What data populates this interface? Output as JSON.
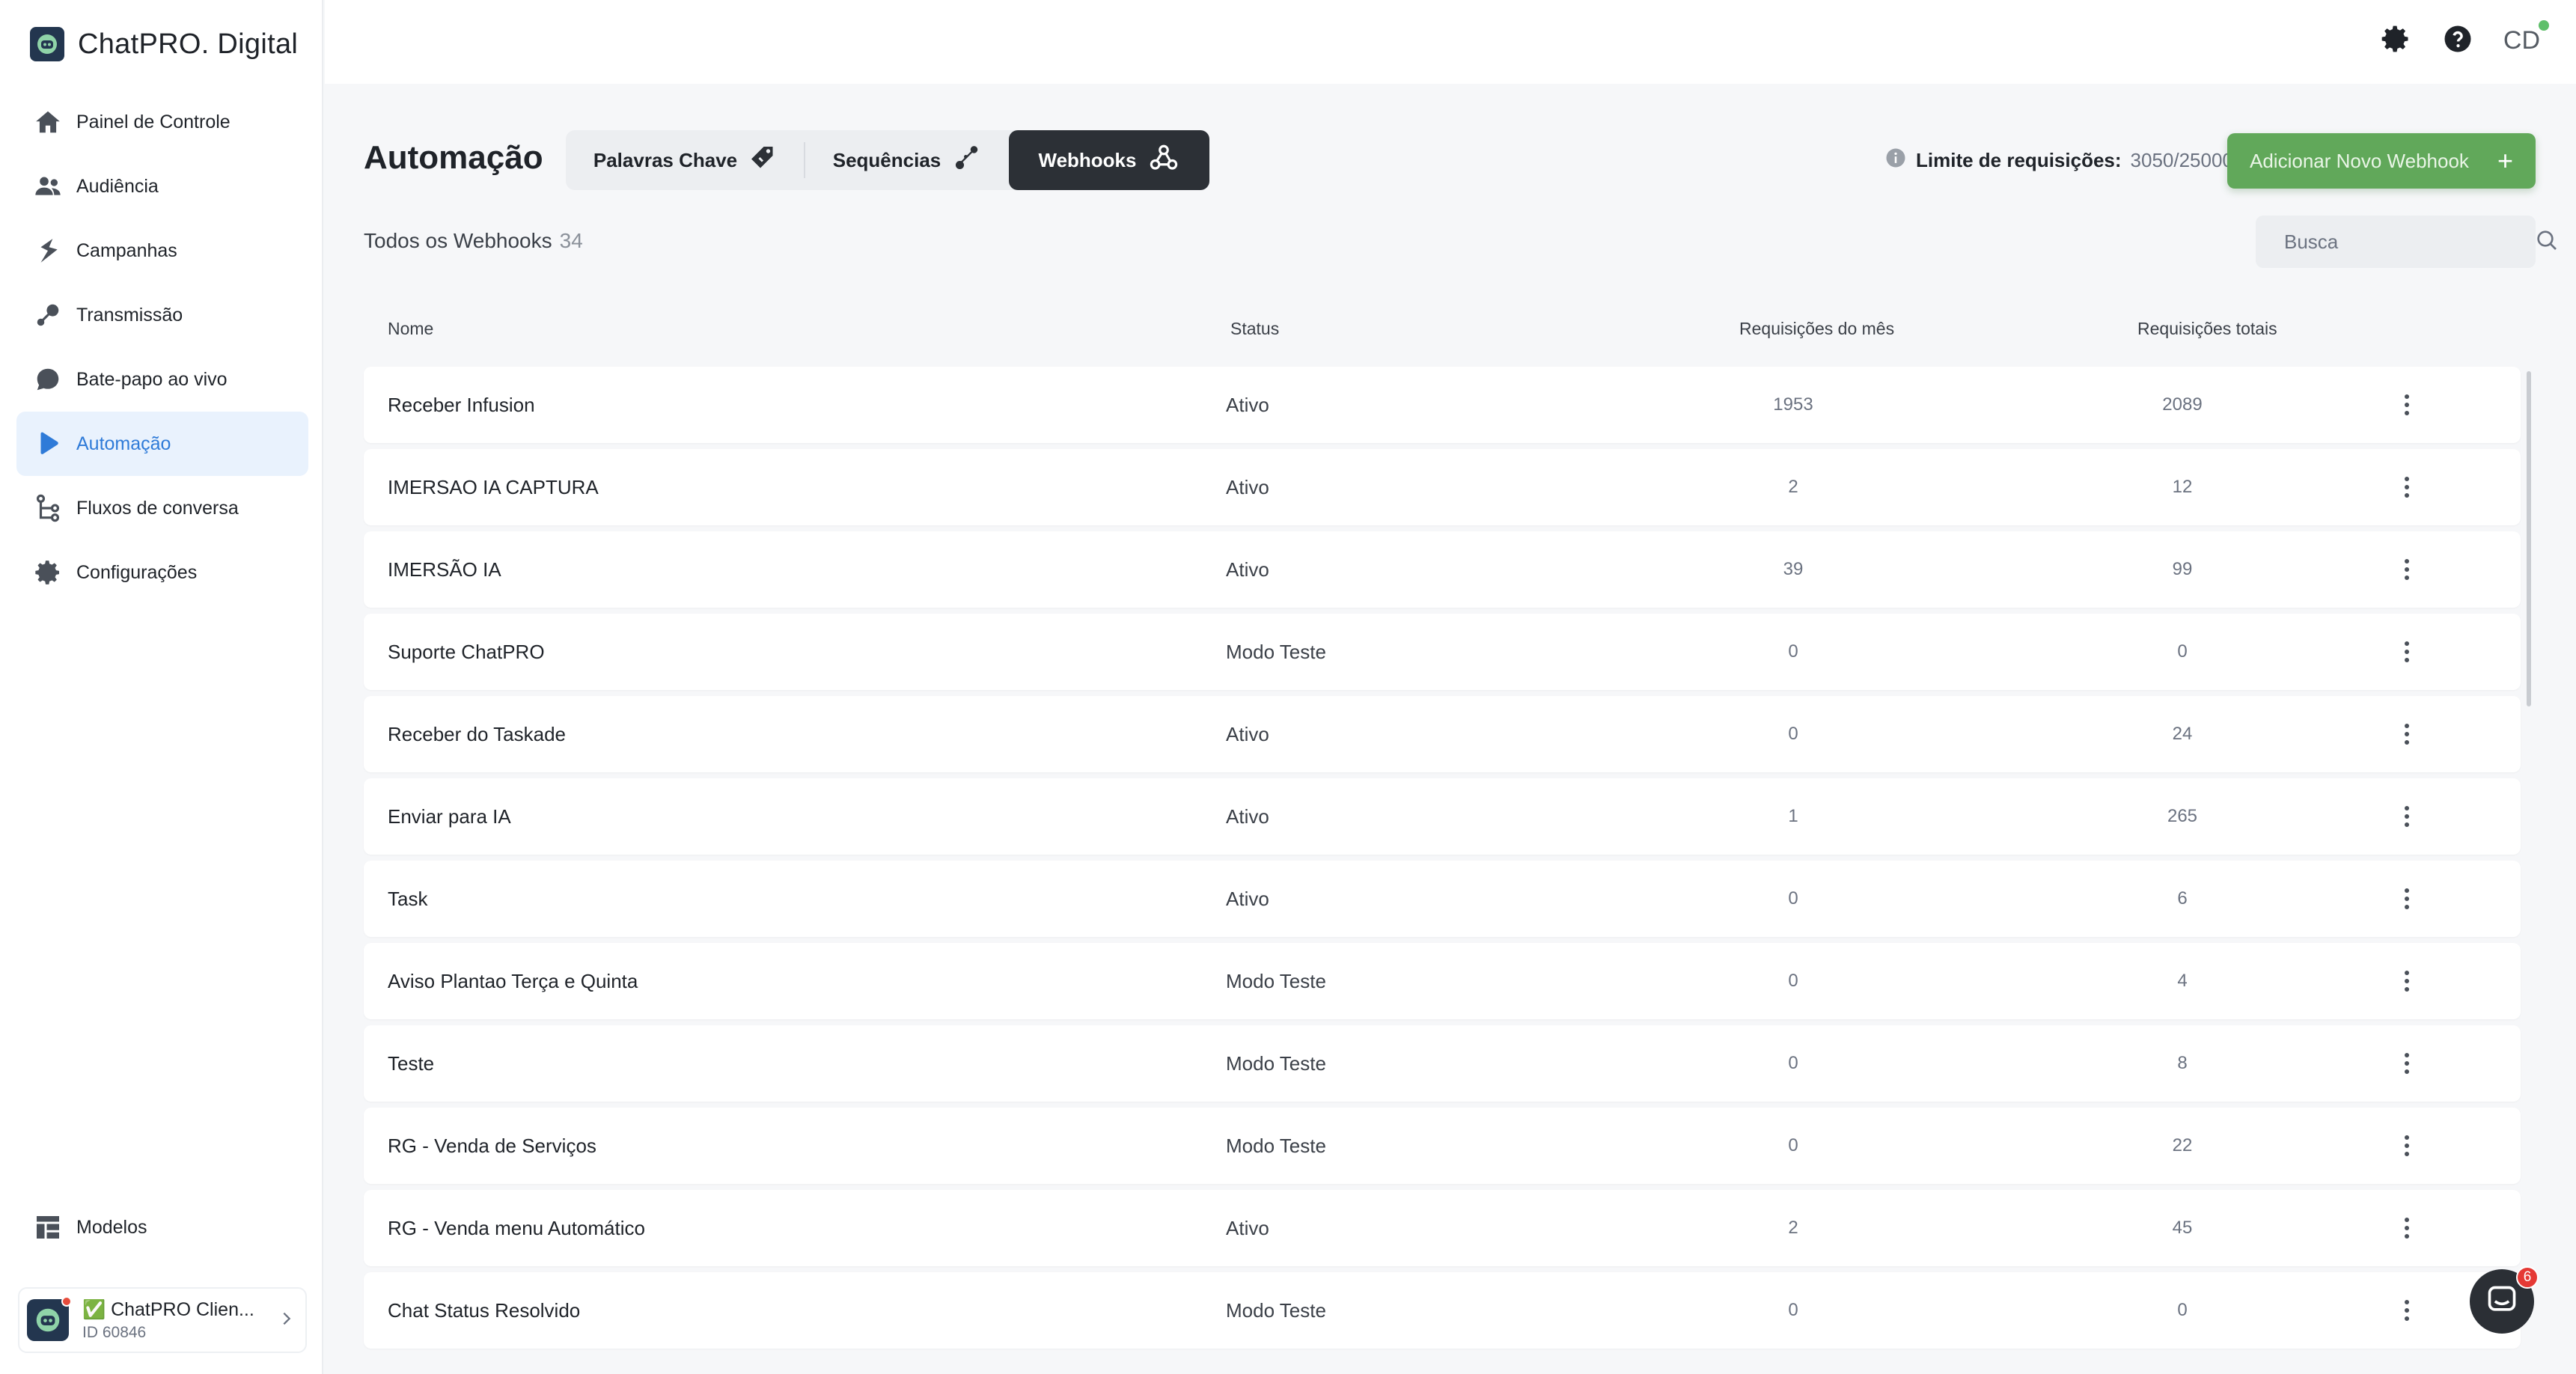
{
  "brand": {
    "name": "ChatPRO. Digital"
  },
  "sidebar": {
    "items": [
      {
        "label": "Painel de Controle",
        "icon": "home-icon"
      },
      {
        "label": "Audiência",
        "icon": "users-icon"
      },
      {
        "label": "Campanhas",
        "icon": "campaign-icon"
      },
      {
        "label": "Transmissão",
        "icon": "broadcast-icon"
      },
      {
        "label": "Bate-papo ao vivo",
        "icon": "chat-bubble-icon"
      },
      {
        "label": "Automação",
        "icon": "automation-icon",
        "active": true
      },
      {
        "label": "Fluxos de conversa",
        "icon": "flow-icon"
      },
      {
        "label": "Configurações",
        "icon": "gear-icon"
      }
    ],
    "bottom_item": {
      "label": "Modelos",
      "icon": "templates-icon"
    },
    "account": {
      "name": "✅ ChatPRO Clien...",
      "id": "ID 60846"
    }
  },
  "header": {
    "user_initials": "CD"
  },
  "main": {
    "title": "Automação",
    "tabs": [
      {
        "label": "Palavras Chave",
        "icon": "tag-icon"
      },
      {
        "label": "Sequências",
        "icon": "sequence-icon"
      },
      {
        "label": "Webhooks",
        "icon": "webhook-icon",
        "active": true
      }
    ],
    "limit": {
      "label": "Limite de requisições:",
      "value": "3050/25000"
    },
    "add_button": "Adicionar Novo Webhook",
    "subtitle": "Todos os Webhooks",
    "count": "34",
    "search_placeholder": "Busca",
    "columns": [
      "Nome",
      "Status",
      "Requisições do mês",
      "Requisições totais"
    ],
    "rows": [
      {
        "name": "Receber Infusion",
        "status": "Ativo",
        "month": "1953",
        "total": "2089"
      },
      {
        "name": "IMERSAO IA CAPTURA",
        "status": "Ativo",
        "month": "2",
        "total": "12"
      },
      {
        "name": "IMERSÃO IA",
        "status": "Ativo",
        "month": "39",
        "total": "99"
      },
      {
        "name": "Suporte ChatPRO",
        "status": "Modo Teste",
        "month": "0",
        "total": "0"
      },
      {
        "name": "Receber do Taskade",
        "status": "Ativo",
        "month": "0",
        "total": "24"
      },
      {
        "name": "Enviar para IA",
        "status": "Ativo",
        "month": "1",
        "total": "265"
      },
      {
        "name": "Task",
        "status": "Ativo",
        "month": "0",
        "total": "6"
      },
      {
        "name": "Aviso Plantao Terça e Quinta",
        "status": "Modo Teste",
        "month": "0",
        "total": "4"
      },
      {
        "name": "Teste",
        "status": "Modo Teste",
        "month": "0",
        "total": "8"
      },
      {
        "name": "RG - Venda de Serviços",
        "status": "Modo Teste",
        "month": "0",
        "total": "22"
      },
      {
        "name": "RG - Venda menu Automático",
        "status": "Ativo",
        "month": "2",
        "total": "45"
      },
      {
        "name": "Chat Status Resolvido",
        "status": "Modo Teste",
        "month": "0",
        "total": "0"
      }
    ]
  },
  "chat_widget": {
    "badge": "6"
  },
  "colors": {
    "accent": "#2f7bd8",
    "primary_button": "#61a85a",
    "active_tab": "#2c3036"
  }
}
